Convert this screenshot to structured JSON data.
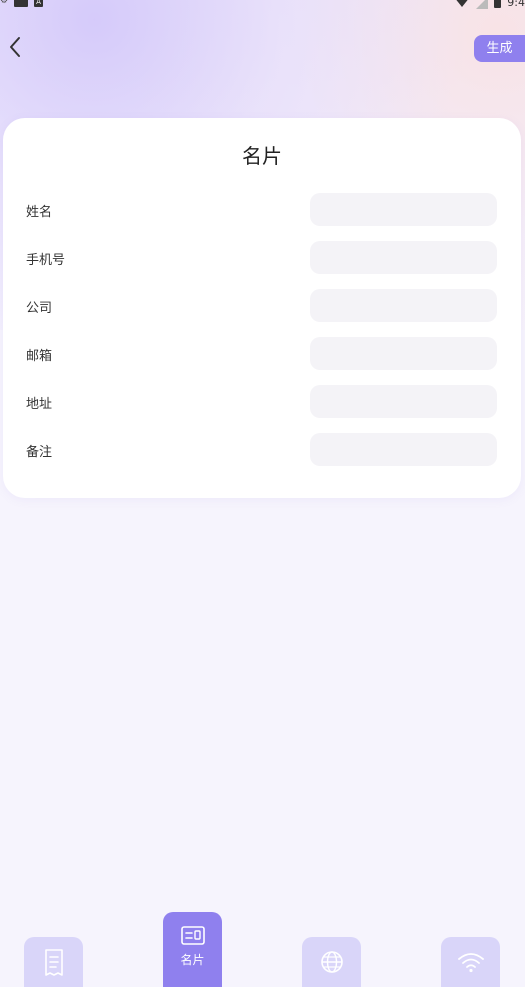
{
  "status_bar": {
    "time": "9:4"
  },
  "header": {
    "generate_label": "生成"
  },
  "card": {
    "title": "名片",
    "fields": [
      {
        "label": "姓名",
        "value": ""
      },
      {
        "label": "手机号",
        "value": ""
      },
      {
        "label": "公司",
        "value": ""
      },
      {
        "label": "邮箱",
        "value": ""
      },
      {
        "label": "地址",
        "value": ""
      },
      {
        "label": "备注",
        "value": ""
      }
    ]
  },
  "tabs": [
    {
      "icon": "receipt-icon",
      "label": ""
    },
    {
      "icon": "id-card-icon",
      "label": "名片",
      "active": true
    },
    {
      "icon": "globe-icon",
      "label": ""
    },
    {
      "icon": "wifi-icon",
      "label": ""
    }
  ],
  "colors": {
    "accent": "#8f80ee",
    "tab_inactive": "#d9d5f9",
    "background": "#f6f4fd"
  }
}
